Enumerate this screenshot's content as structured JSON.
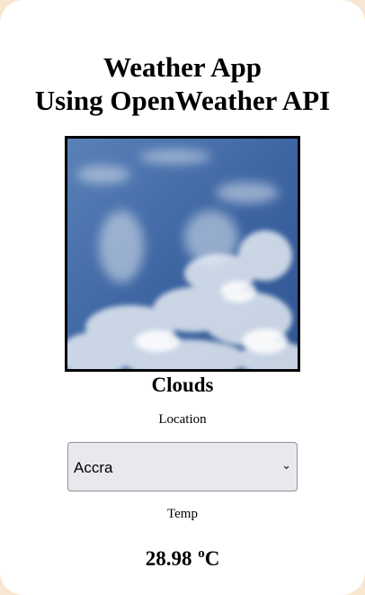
{
  "header": {
    "title_line1": "Weather App",
    "title_line2": "Using OpenWeather API"
  },
  "weather": {
    "image_alt": "sky with clouds",
    "condition": "Clouds",
    "location_label": "Location",
    "location_selected": "Accra",
    "temp_label": "Temp",
    "temp_value": "28.98",
    "temp_degree": "o",
    "temp_unit": "C"
  },
  "icons": {
    "dropdown": "chevron-down-icon"
  },
  "colors": {
    "page_background": "#f9e6d0",
    "card_background": "#ffffff",
    "select_background": "#e9e8ed"
  }
}
